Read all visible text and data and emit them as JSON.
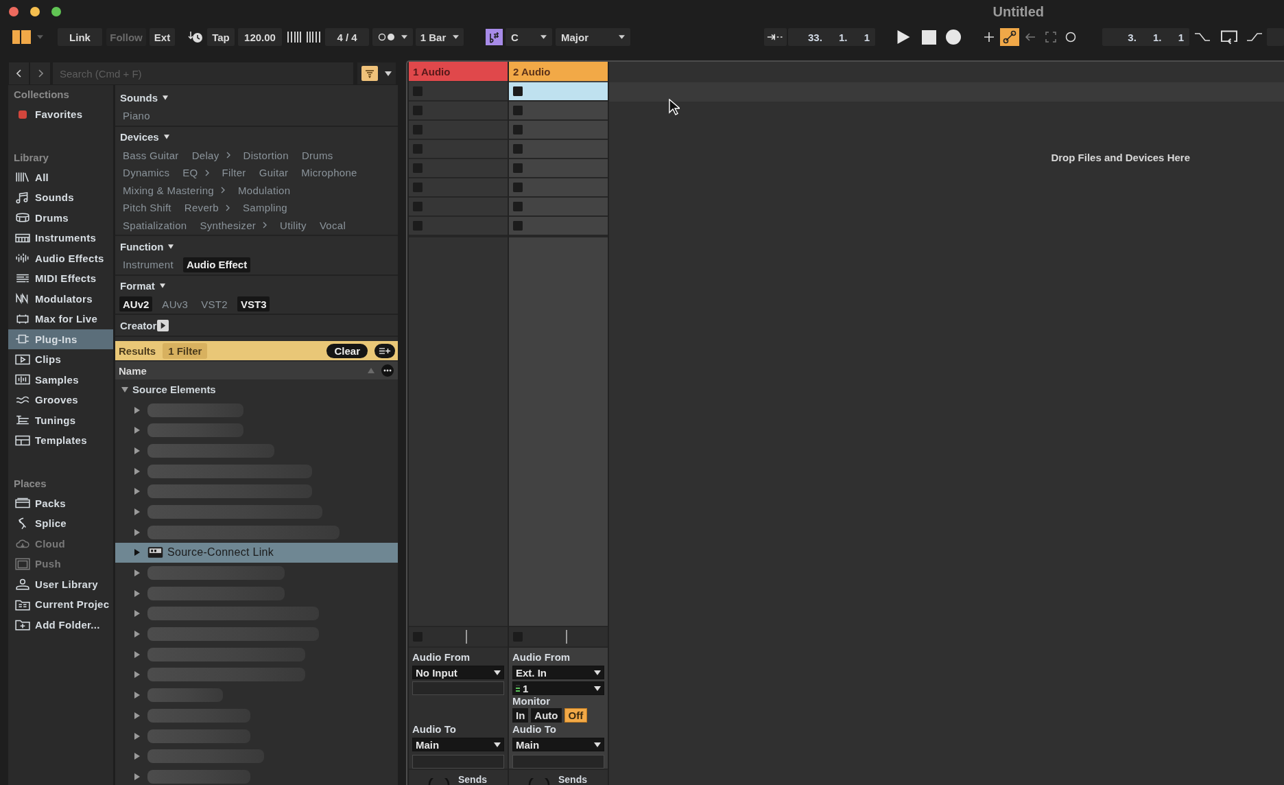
{
  "window": {
    "title": "Untitled"
  },
  "toolbar": {
    "sync_buttons": [
      {
        "label": "Link",
        "disabled": false
      },
      {
        "label": "Follow",
        "disabled": true
      },
      {
        "label": "Ext",
        "disabled": false
      }
    ],
    "tap": "Tap",
    "tempo": "120.00",
    "time_signature": "4 / 4",
    "quantization": "1 Bar",
    "scale_mode": {
      "on": true,
      "key": "C",
      "scale": "Major"
    }
  },
  "transport": {
    "position": "33. 1. 1",
    "automation_arm": {
      "on": true
    },
    "loop_start": "3. 1. 1"
  },
  "browser": {
    "search": {
      "placeholder": "Search (Cmd + F)"
    },
    "filter_view": {
      "on": true
    },
    "sidebar": [
      {
        "heading": "Collections",
        "items": [
          {
            "kind": "tag",
            "label": "Favorites",
            "color": "#d2463c",
            "selected": false,
            "disabled": false
          }
        ]
      },
      {
        "heading": "Library",
        "items": [
          {
            "kind": "all",
            "label": "All",
            "selected": false,
            "disabled": false
          },
          {
            "kind": "sounds",
            "label": "Sounds",
            "selected": false,
            "disabled": false
          },
          {
            "kind": "drums",
            "label": "Drums",
            "selected": false,
            "disabled": false
          },
          {
            "kind": "instruments",
            "label": "Instruments",
            "selected": false,
            "disabled": false
          },
          {
            "kind": "audiofx",
            "label": "Audio Effects",
            "selected": false,
            "disabled": false
          },
          {
            "kind": "midifx",
            "label": "MIDI Effects",
            "selected": false,
            "disabled": false
          },
          {
            "kind": "modulators",
            "label": "Modulators",
            "selected": false,
            "disabled": false
          },
          {
            "kind": "max",
            "label": "Max for Live",
            "selected": false,
            "disabled": false
          },
          {
            "kind": "plugins",
            "label": "Plug-Ins",
            "selected": true,
            "disabled": false
          },
          {
            "kind": "clips",
            "label": "Clips",
            "selected": false,
            "disabled": false
          },
          {
            "kind": "samples",
            "label": "Samples",
            "selected": false,
            "disabled": false
          },
          {
            "kind": "grooves",
            "label": "Grooves",
            "selected": false,
            "disabled": false
          },
          {
            "kind": "tunings",
            "label": "Tunings",
            "selected": false,
            "disabled": false
          },
          {
            "kind": "templates",
            "label": "Templates",
            "selected": false,
            "disabled": false
          }
        ]
      },
      {
        "heading": "Places",
        "items": [
          {
            "kind": "packs",
            "label": "Packs",
            "selected": false,
            "disabled": false
          },
          {
            "kind": "splice",
            "label": "Splice",
            "selected": false,
            "disabled": false
          },
          {
            "kind": "cloud",
            "label": "Cloud",
            "selected": false,
            "disabled": true
          },
          {
            "kind": "push",
            "label": "Push",
            "selected": false,
            "disabled": true
          },
          {
            "kind": "user",
            "label": "User Library",
            "selected": false,
            "disabled": false
          },
          {
            "kind": "project",
            "label": "Current Projec",
            "selected": false,
            "disabled": false
          },
          {
            "kind": "add",
            "label": "Add Folder...",
            "selected": false,
            "disabled": false
          }
        ]
      }
    ],
    "filters": [
      {
        "title": "Sounds",
        "expanded": true,
        "rows": [
          {
            "tags": [
              {
                "label": "Piano",
                "selected": false,
                "submenu": false
              }
            ]
          }
        ]
      },
      {
        "title": "Devices",
        "expanded": true,
        "rows": [
          {
            "tags": [
              {
                "label": "Bass Guitar",
                "selected": false,
                "submenu": false
              },
              {
                "label": "Delay",
                "selected": false,
                "submenu": true
              },
              {
                "label": "Distortion",
                "selected": false,
                "submenu": false
              },
              {
                "label": "Drums",
                "selected": false,
                "submenu": false
              }
            ]
          },
          {
            "tags": [
              {
                "label": "Dynamics",
                "selected": false,
                "submenu": false
              },
              {
                "label": "EQ",
                "selected": false,
                "submenu": true
              },
              {
                "label": "Filter",
                "selected": false,
                "submenu": false
              },
              {
                "label": "Guitar",
                "selected": false,
                "submenu": false
              },
              {
                "label": "Microphone",
                "selected": false,
                "submenu": false
              }
            ]
          },
          {
            "tags": [
              {
                "label": "Mixing & Mastering",
                "selected": false,
                "submenu": true
              },
              {
                "label": "Modulation",
                "selected": false,
                "submenu": false
              }
            ]
          },
          {
            "tags": [
              {
                "label": "Pitch Shift",
                "selected": false,
                "submenu": false
              },
              {
                "label": "Reverb",
                "selected": false,
                "submenu": true
              },
              {
                "label": "Sampling",
                "selected": false,
                "submenu": false
              }
            ]
          },
          {
            "tags": [
              {
                "label": "Spatialization",
                "selected": false,
                "submenu": false
              },
              {
                "label": "Synthesizer",
                "selected": false,
                "submenu": true
              },
              {
                "label": "Utility",
                "selected": false,
                "submenu": false
              },
              {
                "label": "Vocal",
                "selected": false,
                "submenu": false
              }
            ]
          }
        ]
      },
      {
        "title": "Function",
        "expanded": true,
        "rows": [
          {
            "tags": [
              {
                "label": "Instrument",
                "selected": false,
                "submenu": false
              },
              {
                "label": "Audio Effect",
                "selected": true,
                "submenu": false
              }
            ]
          }
        ]
      },
      {
        "title": "Format",
        "expanded": true,
        "rows": [
          {
            "tags": [
              {
                "label": "AUv2",
                "selected": true,
                "submenu": false
              },
              {
                "label": "AUv3",
                "selected": false,
                "submenu": false
              },
              {
                "label": "VST2",
                "selected": false,
                "submenu": false
              },
              {
                "label": "VST3",
                "selected": true,
                "submenu": false
              }
            ]
          }
        ]
      },
      {
        "title": "Creator",
        "expanded": false
      }
    ],
    "results": {
      "label": "Results",
      "filter_count": "1 Filter",
      "clear": "Clear"
    },
    "name_column": {
      "label": "Name",
      "sorted": true
    },
    "tree": {
      "label": "Source Elements",
      "expanded": true,
      "children": [
        {
          "kind": "blurred",
          "selected": false,
          "expanded": false
        },
        {
          "kind": "blurred",
          "selected": false,
          "expanded": false
        },
        {
          "kind": "blurred",
          "selected": false,
          "expanded": false
        },
        {
          "kind": "blurred",
          "selected": false,
          "expanded": false
        },
        {
          "kind": "blurred",
          "selected": false,
          "expanded": false
        },
        {
          "kind": "blurred",
          "selected": false,
          "expanded": false
        },
        {
          "kind": "blurred",
          "selected": false,
          "expanded": false
        },
        {
          "kind": "plugin",
          "name": "Source-Connect Link",
          "selected": true,
          "expanded": false
        },
        {
          "kind": "blurred",
          "selected": false,
          "expanded": false
        },
        {
          "kind": "blurred",
          "selected": false,
          "expanded": false
        },
        {
          "kind": "blurred",
          "selected": false,
          "expanded": false
        },
        {
          "kind": "blurred",
          "selected": false,
          "expanded": false
        },
        {
          "kind": "blurred",
          "selected": false,
          "expanded": false
        },
        {
          "kind": "blurred",
          "selected": false,
          "expanded": false
        },
        {
          "kind": "blurred",
          "selected": false,
          "expanded": false
        },
        {
          "kind": "blurred",
          "selected": false,
          "expanded": false
        },
        {
          "kind": "blurred",
          "selected": false,
          "expanded": false
        },
        {
          "kind": "blurred",
          "selected": false,
          "expanded": false
        },
        {
          "kind": "blurred",
          "selected": false,
          "expanded": false
        }
      ]
    }
  },
  "tracks": [
    {
      "name": "1 Audio",
      "color": "#e0484b",
      "selected": false,
      "clip_slots": [
        {
          "selected": false
        },
        {
          "selected": false
        },
        {
          "selected": false
        },
        {
          "selected": false
        },
        {
          "selected": false
        },
        {
          "selected": false
        },
        {
          "selected": false
        },
        {
          "selected": false
        }
      ],
      "audio_from": {
        "label": "Audio From",
        "type": "No Input"
      },
      "audio_to": {
        "label": "Audio To",
        "destination": "Main"
      },
      "sends": {
        "label": "Sends"
      }
    },
    {
      "name": "2 Audio",
      "color": "#f2a947",
      "selected": true,
      "clip_slots": [
        {
          "selected": true
        },
        {
          "selected": false
        },
        {
          "selected": false
        },
        {
          "selected": false
        },
        {
          "selected": false
        },
        {
          "selected": false
        },
        {
          "selected": false
        },
        {
          "selected": false
        }
      ],
      "audio_from": {
        "label": "Audio From",
        "type": "Ext. In",
        "channel": "1"
      },
      "monitor": {
        "label": "Monitor",
        "options": [
          {
            "label": "In",
            "selected": false
          },
          {
            "label": "Auto",
            "selected": false
          },
          {
            "label": "Off",
            "selected": true
          }
        ]
      },
      "audio_to": {
        "label": "Audio To",
        "destination": "Main"
      },
      "sends": {
        "label": "Sends"
      }
    }
  ],
  "drop_zone": {
    "hint": "Drop Files and Devices Here"
  }
}
